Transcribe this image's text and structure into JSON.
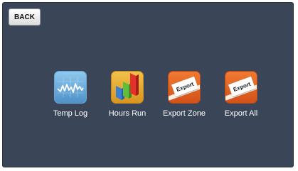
{
  "header": {
    "back_label": "BACK"
  },
  "apps": [
    {
      "label": "Temp Log",
      "icon": "temperature-chart-icon"
    },
    {
      "label": "Hours Run",
      "icon": "bar-chart-icon"
    },
    {
      "label": "Export Zone",
      "icon": "export-icon",
      "icon_text": "Export"
    },
    {
      "label": "Export All",
      "icon": "export-icon",
      "icon_text": "Export"
    }
  ],
  "colors": {
    "background": "#3a4657",
    "temp_icon": "#4f92c8",
    "hours_icon": "#e0a12a",
    "export_icon": "#e0622a"
  }
}
